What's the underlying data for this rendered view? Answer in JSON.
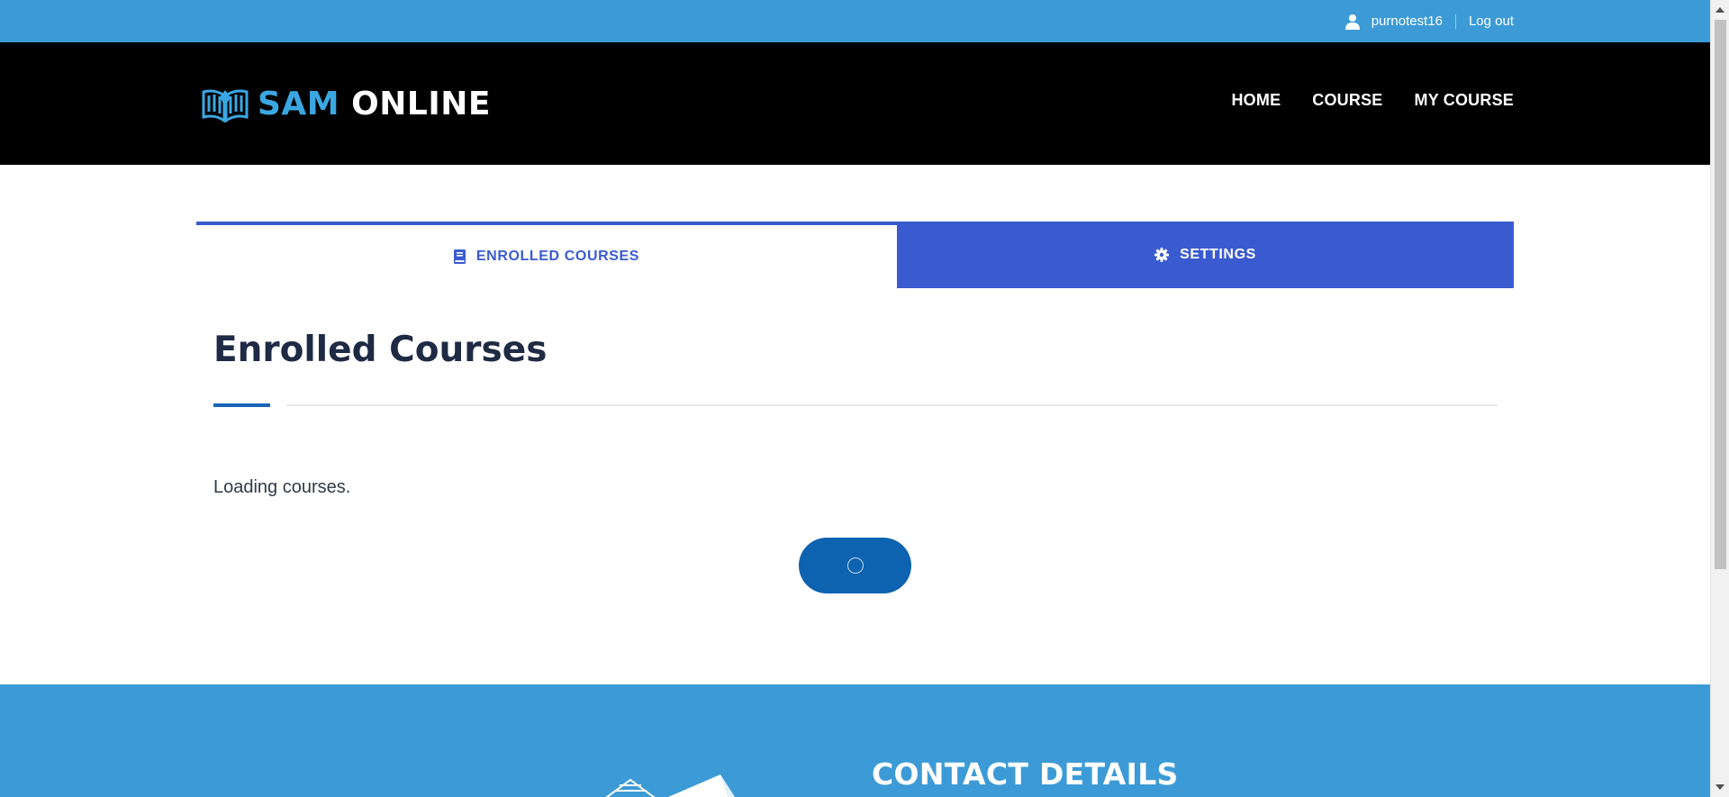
{
  "topbar": {
    "username": "purnotest16",
    "logout_label": "Log out",
    "user_icon": "user-icon",
    "background_color": "#3c9bd6"
  },
  "header": {
    "logo_word1": "SAM",
    "logo_word2": "ONLINE",
    "logo_icon": "open-book-logo",
    "brand_color": "#3ba7e2",
    "nav": [
      {
        "label": "HOME"
      },
      {
        "label": "COURSE"
      },
      {
        "label": "MY COURSE"
      }
    ]
  },
  "tabs": {
    "enrolled_label": "ENROLLED COURSES",
    "enrolled_icon": "book-icon",
    "settings_label": "SETTINGS",
    "settings_icon": "gear-icon",
    "accent_color": "#3a5bd0"
  },
  "main": {
    "heading": "Enrolled Courses",
    "loading_text": "Loading courses.",
    "loader_icon": "spinner-icon"
  },
  "footer": {
    "title": "CONTACT DETAILS"
  }
}
